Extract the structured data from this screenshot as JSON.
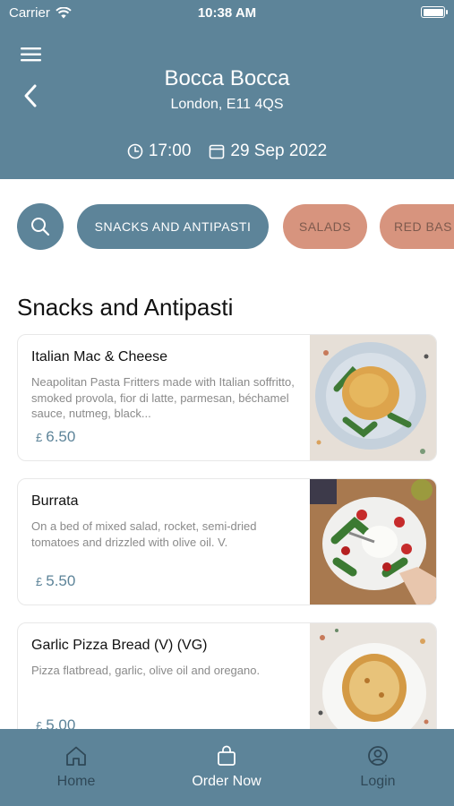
{
  "status_bar": {
    "carrier": "Carrier",
    "time": "10:38 AM"
  },
  "header": {
    "title": "Bocca Bocca",
    "subtitle": "London, E11 4QS",
    "time": "17:00",
    "date": "29 Sep 2022"
  },
  "categories": [
    {
      "label": "SNACKS AND ANTIPASTI",
      "active": true
    },
    {
      "label": "SALADS",
      "active": false
    },
    {
      "label": "RED BAS",
      "active": false
    }
  ],
  "section_title": "Snacks and Antipasti",
  "items": [
    {
      "name": "Italian Mac & Cheese",
      "description": "Neapolitan Pasta Fritters made with Italian soffritto, smoked provola, fior di latte, parmesan, béchamel sauce, nutmeg, black...",
      "currency": "£",
      "price": "6.50"
    },
    {
      "name": "Burrata",
      "description": "On a bed of mixed salad, rocket, semi-dried tomatoes and drizzled with olive oil. V.",
      "currency": "£",
      "price": "5.50"
    },
    {
      "name": "Garlic Pizza Bread (V) (VG)",
      "description": "Pizza flatbread, garlic, olive oil and oregano.",
      "currency": "£",
      "price": "5.00"
    }
  ],
  "tabbar": [
    {
      "label": "Home",
      "icon": "home-icon"
    },
    {
      "label": "Order Now",
      "icon": "bag-icon",
      "active": true
    },
    {
      "label": "Login",
      "icon": "user-icon"
    }
  ],
  "colors": {
    "primary": "#5d8499",
    "chip_inactive": "#d7947e",
    "price": "#5d8499"
  }
}
